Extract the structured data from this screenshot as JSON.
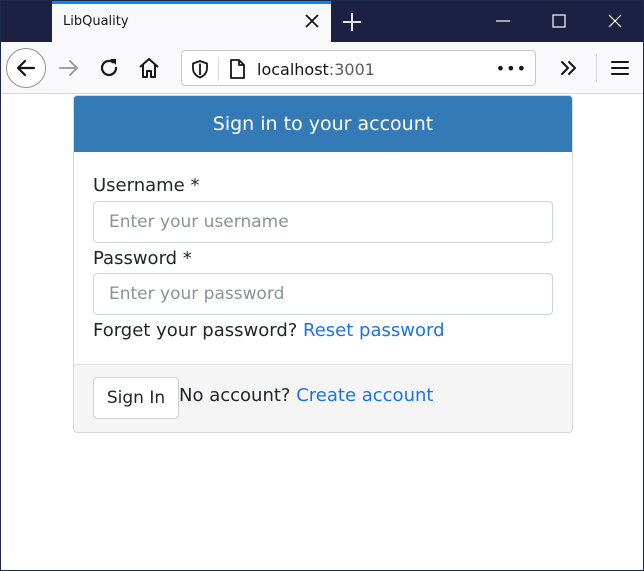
{
  "browser": {
    "tab_title": "LibQuality",
    "url_host": "localhost",
    "url_port": ":3001",
    "url_more": "•••"
  },
  "login": {
    "heading": "Sign in to your account",
    "username_label": "Username *",
    "username_placeholder": "Enter your username",
    "password_label": "Password *",
    "password_placeholder": "Enter your password",
    "forgot_text": "Forget your password?",
    "reset_link": "Reset password",
    "signin_button": "Sign In",
    "no_account_text": "No account?",
    "create_link": "Create account"
  },
  "colors": {
    "header_bg": "#337ab7",
    "link": "#1a73e8",
    "titlebar": "#1c2143",
    "tab_accent": "#0a84ff"
  }
}
